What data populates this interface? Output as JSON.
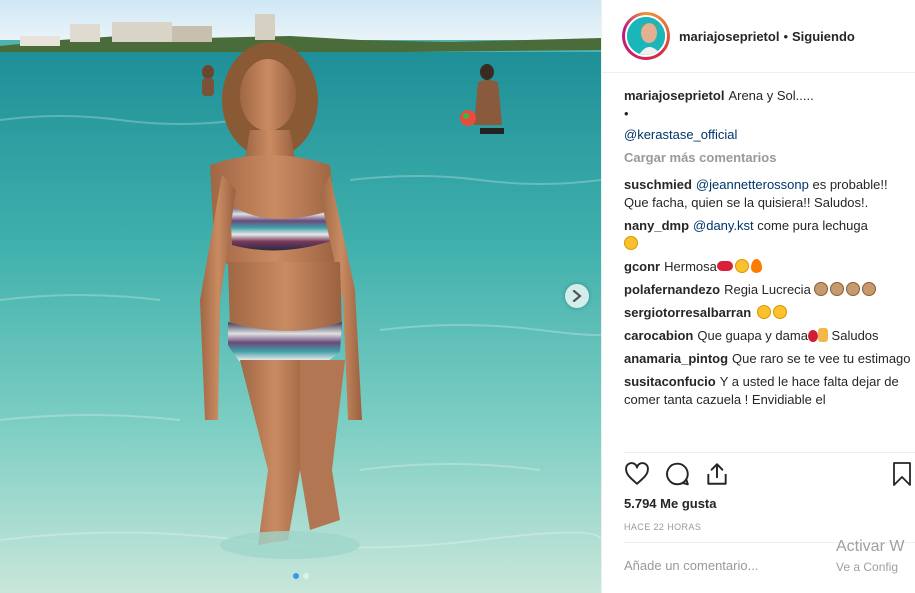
{
  "post": {
    "username": "mariajoseprietol",
    "separator": "•",
    "follow_state": "Siguiendo",
    "caption": {
      "user": "mariajoseprietol",
      "text": "Arena y Sol.....",
      "bullet": "•",
      "tag": "@kerastase_official"
    },
    "load_more": "Cargar más comentarios",
    "comments": [
      {
        "user": "suschmied",
        "mention": "@jeannetterossonp",
        "text": " es probable!! Que facha, quien se la quisiera!! Saludos!."
      },
      {
        "user": "nany_dmp",
        "mention": "@dany.kst",
        "text": " come pura lechuga"
      },
      {
        "user": "gconr",
        "mention": "",
        "text": "Hermosa"
      },
      {
        "user": "polafernandezo",
        "mention": "",
        "text": "Regia Lucrecia"
      },
      {
        "user": "sergiotorresalbarran",
        "mention": "",
        "text": ""
      },
      {
        "user": "carocabion",
        "mention": "",
        "text": "Que guapa y dama"
      },
      {
        "user": "anamaria_pintog",
        "mention": "",
        "text": "Que raro se te vee tu estimago"
      },
      {
        "user": "susitaconfucio",
        "mention": "",
        "text": "Y a usted le hace falta dejar de comer tanta cazuela ! Envidiable el"
      }
    ],
    "carocabion_suffix": " Saludos",
    "likes": "5.794 Me gusta",
    "timestamp": "HACE 22 HORAS",
    "add_comment_placeholder": "Añade un comentario...",
    "icons": {
      "like": "heart-icon",
      "comment": "comment-bubble-icon",
      "share": "share-icon",
      "save": "bookmark-icon",
      "next": "chevron-right-icon"
    }
  },
  "carousel": {
    "count": 2,
    "active": 0
  },
  "watermark": {
    "line1": "Activar W",
    "line2": "Ve a Config"
  },
  "colors": {
    "mention": "#003569",
    "muted": "#999999",
    "text": "#262626",
    "active_dot": "#3897f0"
  }
}
